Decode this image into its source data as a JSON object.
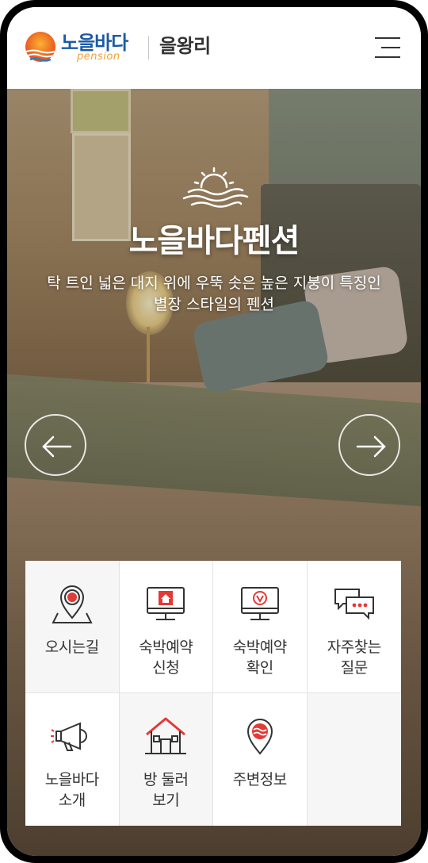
{
  "header": {
    "logo_text": "노을바다",
    "logo_sub": "pension",
    "location": "을왕리",
    "menu_icon": "hamburger-menu-icon"
  },
  "hero": {
    "emblem_icon": "sunset-waves-icon",
    "title": "노을바다펜션",
    "description": "탁 트인 넓은 대지 위에 우뚝 솟은 높은 지붕이 특징인 별장 스타일의 펜션",
    "prev_icon": "arrow-left-icon",
    "next_icon": "arrow-right-icon"
  },
  "quick_menu": [
    {
      "label": "오시는길",
      "icon": "map-pin-icon"
    },
    {
      "label": "숙박예약\n신청",
      "icon": "monitor-home-icon"
    },
    {
      "label": "숙박예약\n확인",
      "icon": "monitor-check-icon"
    },
    {
      "label": "자주찾는\n질문",
      "icon": "chat-bubbles-icon"
    },
    {
      "label": "노을바다\n소개",
      "icon": "megaphone-icon"
    },
    {
      "label": "방 둘러\n보기",
      "icon": "house-icon"
    },
    {
      "label": "주변정보",
      "icon": "location-waves-icon"
    },
    {
      "label": "",
      "icon": ""
    }
  ],
  "colors": {
    "brand_blue": "#1b5aa6",
    "brand_orange": "#f0a13a",
    "accent_red": "#e53935"
  }
}
